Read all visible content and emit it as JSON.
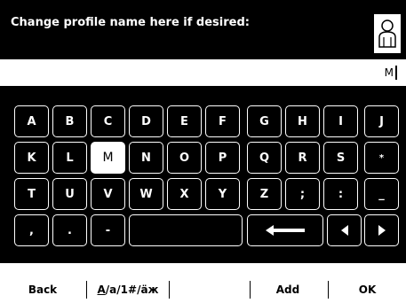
{
  "header": {
    "title": "Change profile name here if desired:",
    "icon": "user-profile-icon"
  },
  "entry": {
    "value": "M"
  },
  "keyboard": {
    "row1": [
      "A",
      "B",
      "C",
      "D",
      "E",
      "F",
      "G",
      "H",
      "I",
      "J"
    ],
    "row2": [
      "K",
      "L",
      "M",
      "N",
      "O",
      "P",
      "Q",
      "R",
      "S",
      "*"
    ],
    "row3": [
      "T",
      "U",
      "V",
      "W",
      "X",
      "Y",
      "Z",
      ";",
      ":",
      "_"
    ],
    "row4": [
      ",",
      ".",
      "-"
    ],
    "selected_key": "M",
    "backspace_icon": "arrow-left-icon",
    "cursor_left_icon": "triangle-left-icon",
    "cursor_right_icon": "triangle-right-icon"
  },
  "softkeys": {
    "back": "Back",
    "mode_underlined": "A",
    "mode_rest": "/a/1#/äж",
    "add": "Add",
    "ok": "OK"
  }
}
